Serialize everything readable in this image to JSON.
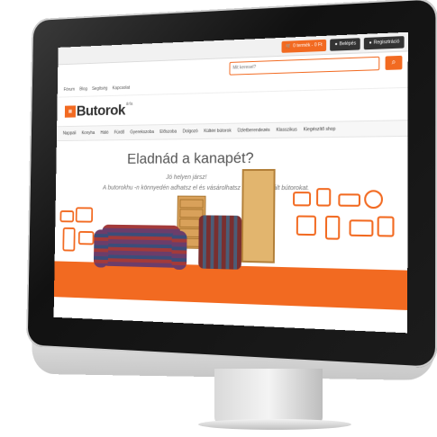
{
  "topbar": {
    "cart_label": "0 termék - 0 Ft",
    "login_label": "Belépés",
    "register_label": "Regisztráció"
  },
  "search": {
    "placeholder": "Mit keresel?"
  },
  "links": [
    "Fórum",
    "Blog",
    "Segítség",
    "Kapcsolat"
  ],
  "logo": {
    "brand": "Butorok",
    "sup": "árla",
    "tld": ".hu"
  },
  "menu": [
    "Nappali",
    "Konyha",
    "Háló",
    "Fürdő",
    "Gyerekszoba",
    "Előszoba",
    "Dolgozó",
    "Kültéri bútorok",
    "Üzletberendezés",
    "Klasszikus",
    "Kiegészítő shop"
  ],
  "hero": {
    "title": "Eladnád a kanapét?",
    "subtitle1": "Jó helyen jársz!",
    "subtitle2": "A butorokhu -n könnyedén adhatsz el és vásárolhatsz új és használt bútorokat."
  },
  "colors": {
    "accent": "#f26a21"
  }
}
